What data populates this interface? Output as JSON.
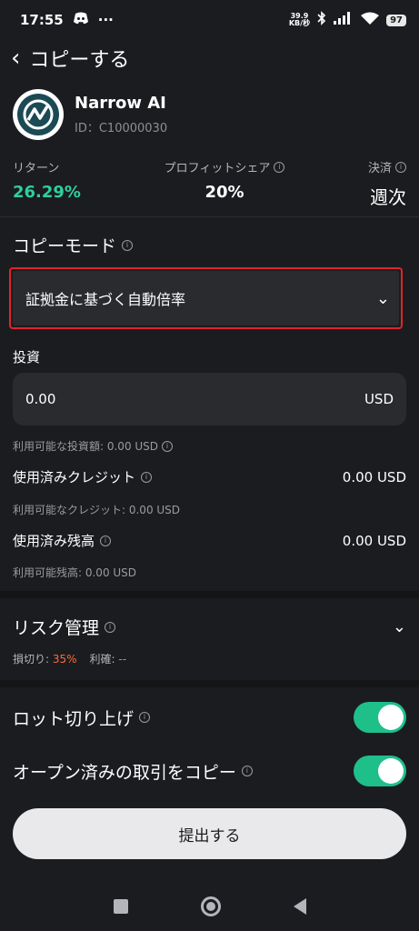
{
  "status_bar": {
    "time": "17:55",
    "net_speed_value": "39.9",
    "net_speed_unit": "KB/秒",
    "battery": "97"
  },
  "header": {
    "title": "コピーする"
  },
  "trader": {
    "name": "Narrow AI",
    "id": "ID：C10000030"
  },
  "stats": {
    "return_label": "リターン",
    "return_value": "26.29%",
    "profit_share_label": "プロフィットシェア",
    "profit_share_value": "20%",
    "settlement_label": "決済",
    "settlement_value": "週次"
  },
  "copy_mode": {
    "title": "コピーモード",
    "selected": "証拠金に基づく自動倍率"
  },
  "investment": {
    "label": "投資",
    "value": "0.00",
    "currency": "USD",
    "available": "利用可能な投資額: 0.00 USD"
  },
  "credit": {
    "used_label": "使用済みクレジット",
    "used_value": "0.00 USD",
    "available": "利用可能なクレジット: 0.00 USD"
  },
  "balance": {
    "used_label": "使用済み残高",
    "used_value": "0.00 USD",
    "available": "利用可能残高: 0.00 USD"
  },
  "risk": {
    "title": "リスク管理",
    "stop_loss_label": "損切り:",
    "stop_loss_value": "35%",
    "take_profit_label": "利確:",
    "take_profit_value": "--"
  },
  "toggles": {
    "lot_round_up_label": "ロット切り上げ",
    "lot_round_up_on": true,
    "copy_open_label": "オープン済みの取引をコピー",
    "copy_open_on": true
  },
  "submit_label": "提出する",
  "colors": {
    "background": "#1b1c1f",
    "accent_green": "#2fcf9b",
    "toggle_green": "#1fbf8a",
    "loss_orange": "#ff6a3d",
    "highlight_red": "#e32229"
  }
}
